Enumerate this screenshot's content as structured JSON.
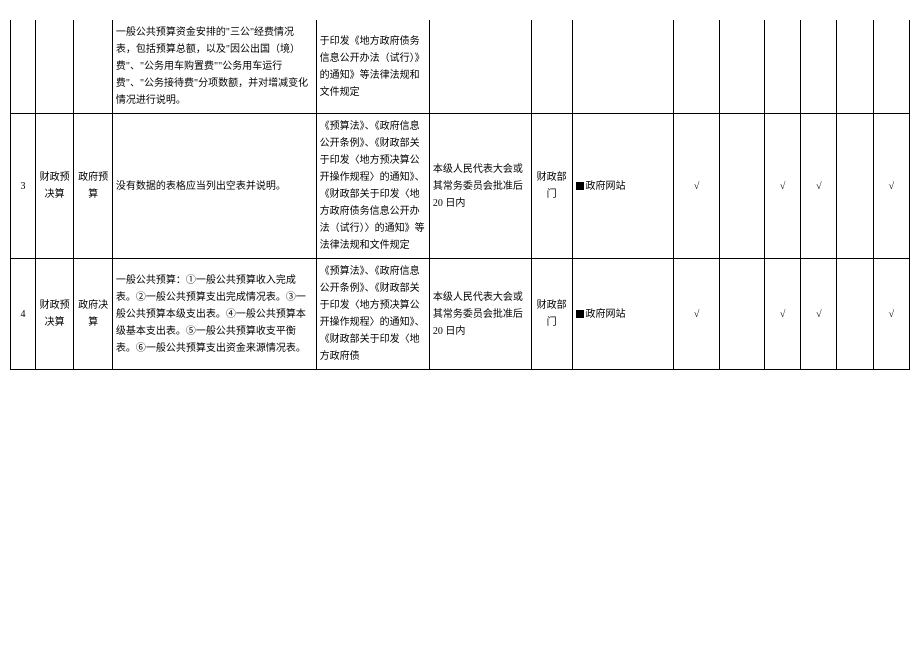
{
  "rows": [
    {
      "desc": "一般公共预算资金安排的\"三公\"经费情况表，包括预算总额，以及\"因公出国（境）费\"、\"公务用车购置费\"\"公务用车运行费\"、\"公务接待费\"分项数额，并对增减变化情况进行说明。",
      "basis": "于印发《地方政府债务信息公开办法（试行）》的通知》等法律法规和文件规定"
    },
    {
      "idx": "3",
      "cat": "财政预决算",
      "sub": "政府预算",
      "desc": "没有数据的表格应当列出空表并说明。",
      "basis": "《预算法》、《政府信息公开条例》、《财政部关于印发〈地方预决算公开操作规程〉的通知》、《财政部关于印发〈地方政府债务信息公开办法（试行）〉的通知》等法律法规和文件规定",
      "time": "本级人民代表大会或其常务委员会批准后 20 日内",
      "dept": "财政部门",
      "channel": "政府网站",
      "chk1": "√",
      "chk3": "√",
      "chk4": "√",
      "chk6": "√"
    },
    {
      "idx": "4",
      "cat": "财政预决算",
      "sub": "政府决算",
      "desc": "一般公共预算：①一般公共预算收入完成表。②一般公共预算支出完成情况表。③一般公共预算本级支出表。④一般公共预算本级基本支出表。⑤一般公共预算收支平衡表。⑥一般公共预算支出资金来源情况表。",
      "basis": "《预算法》、《政府信息公开条例》、《财政部关于印发〈地方预决算公开操作规程〉的通知》、《财政部关于印发〈地方政府债",
      "time": "本级人民代表大会或其常务委员会批准后 20 日内",
      "dept": "财政部门",
      "channel": "政府网站",
      "chk1": "√",
      "chk3": "√",
      "chk4": "√",
      "chk6": "√"
    }
  ]
}
